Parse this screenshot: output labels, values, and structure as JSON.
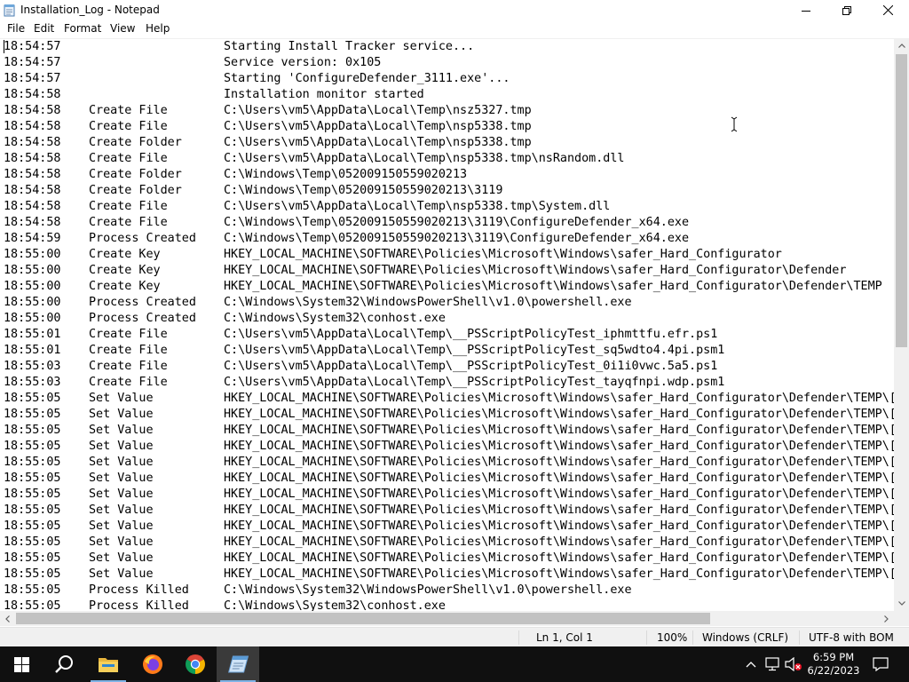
{
  "window": {
    "title": "Installation_Log - Notepad",
    "icon": "notepad-icon"
  },
  "menu": [
    "File",
    "Edit",
    "Format",
    "View",
    "Help"
  ],
  "log": [
    {
      "time": "18:54:57",
      "op": "",
      "path": "Starting Install Tracker service..."
    },
    {
      "time": "18:54:57",
      "op": "",
      "path": "Service version: 0x105"
    },
    {
      "time": "18:54:57",
      "op": "",
      "path": "Starting 'ConfigureDefender_3111.exe'..."
    },
    {
      "time": "18:54:58",
      "op": "",
      "path": "Installation monitor started"
    },
    {
      "time": "18:54:58",
      "op": "Create File",
      "path": "C:\\Users\\vm5\\AppData\\Local\\Temp\\nsz5327.tmp"
    },
    {
      "time": "18:54:58",
      "op": "Create File",
      "path": "C:\\Users\\vm5\\AppData\\Local\\Temp\\nsp5338.tmp"
    },
    {
      "time": "18:54:58",
      "op": "Create Folder",
      "path": "C:\\Users\\vm5\\AppData\\Local\\Temp\\nsp5338.tmp"
    },
    {
      "time": "18:54:58",
      "op": "Create File",
      "path": "C:\\Users\\vm5\\AppData\\Local\\Temp\\nsp5338.tmp\\nsRandom.dll"
    },
    {
      "time": "18:54:58",
      "op": "Create Folder",
      "path": "C:\\Windows\\Temp\\052009150559020213"
    },
    {
      "time": "18:54:58",
      "op": "Create Folder",
      "path": "C:\\Windows\\Temp\\052009150559020213\\3119"
    },
    {
      "time": "18:54:58",
      "op": "Create File",
      "path": "C:\\Users\\vm5\\AppData\\Local\\Temp\\nsp5338.tmp\\System.dll"
    },
    {
      "time": "18:54:58",
      "op": "Create File",
      "path": "C:\\Windows\\Temp\\052009150559020213\\3119\\ConfigureDefender_x64.exe"
    },
    {
      "time": "18:54:59",
      "op": "Process Created",
      "path": "C:\\Windows\\Temp\\052009150559020213\\3119\\ConfigureDefender_x64.exe"
    },
    {
      "time": "18:55:00",
      "op": "Create Key",
      "path": "HKEY_LOCAL_MACHINE\\SOFTWARE\\Policies\\Microsoft\\Windows\\safer_Hard_Configurator"
    },
    {
      "time": "18:55:00",
      "op": "Create Key",
      "path": "HKEY_LOCAL_MACHINE\\SOFTWARE\\Policies\\Microsoft\\Windows\\safer_Hard_Configurator\\Defender"
    },
    {
      "time": "18:55:00",
      "op": "Create Key",
      "path": "HKEY_LOCAL_MACHINE\\SOFTWARE\\Policies\\Microsoft\\Windows\\safer_Hard_Configurator\\Defender\\TEMP"
    },
    {
      "time": "18:55:00",
      "op": "Process Created",
      "path": "C:\\Windows\\System32\\WindowsPowerShell\\v1.0\\powershell.exe"
    },
    {
      "time": "18:55:00",
      "op": "Process Created",
      "path": "C:\\Windows\\System32\\conhost.exe"
    },
    {
      "time": "18:55:01",
      "op": "Create File",
      "path": "C:\\Users\\vm5\\AppData\\Local\\Temp\\__PSScriptPolicyTest_iphmttfu.efr.ps1"
    },
    {
      "time": "18:55:01",
      "op": "Create File",
      "path": "C:\\Users\\vm5\\AppData\\Local\\Temp\\__PSScriptPolicyTest_sq5wdto4.4pi.psm1"
    },
    {
      "time": "18:55:03",
      "op": "Create File",
      "path": "C:\\Users\\vm5\\AppData\\Local\\Temp\\__PSScriptPolicyTest_0i1i0vwc.5a5.ps1"
    },
    {
      "time": "18:55:03",
      "op": "Create File",
      "path": "C:\\Users\\vm5\\AppData\\Local\\Temp\\__PSScriptPolicyTest_tayqfnpi.wdp.psm1"
    },
    {
      "time": "18:55:05",
      "op": "Set Value",
      "path": "HKEY_LOCAL_MACHINE\\SOFTWARE\\Policies\\Microsoft\\Windows\\safer_Hard_Configurator\\Defender\\TEMP\\["
    },
    {
      "time": "18:55:05",
      "op": "Set Value",
      "path": "HKEY_LOCAL_MACHINE\\SOFTWARE\\Policies\\Microsoft\\Windows\\safer_Hard_Configurator\\Defender\\TEMP\\["
    },
    {
      "time": "18:55:05",
      "op": "Set Value",
      "path": "HKEY_LOCAL_MACHINE\\SOFTWARE\\Policies\\Microsoft\\Windows\\safer_Hard_Configurator\\Defender\\TEMP\\["
    },
    {
      "time": "18:55:05",
      "op": "Set Value",
      "path": "HKEY_LOCAL_MACHINE\\SOFTWARE\\Policies\\Microsoft\\Windows\\safer_Hard_Configurator\\Defender\\TEMP\\["
    },
    {
      "time": "18:55:05",
      "op": "Set Value",
      "path": "HKEY_LOCAL_MACHINE\\SOFTWARE\\Policies\\Microsoft\\Windows\\safer_Hard_Configurator\\Defender\\TEMP\\["
    },
    {
      "time": "18:55:05",
      "op": "Set Value",
      "path": "HKEY_LOCAL_MACHINE\\SOFTWARE\\Policies\\Microsoft\\Windows\\safer_Hard_Configurator\\Defender\\TEMP\\["
    },
    {
      "time": "18:55:05",
      "op": "Set Value",
      "path": "HKEY_LOCAL_MACHINE\\SOFTWARE\\Policies\\Microsoft\\Windows\\safer_Hard_Configurator\\Defender\\TEMP\\["
    },
    {
      "time": "18:55:05",
      "op": "Set Value",
      "path": "HKEY_LOCAL_MACHINE\\SOFTWARE\\Policies\\Microsoft\\Windows\\safer_Hard_Configurator\\Defender\\TEMP\\["
    },
    {
      "time": "18:55:05",
      "op": "Set Value",
      "path": "HKEY_LOCAL_MACHINE\\SOFTWARE\\Policies\\Microsoft\\Windows\\safer_Hard_Configurator\\Defender\\TEMP\\["
    },
    {
      "time": "18:55:05",
      "op": "Set Value",
      "path": "HKEY_LOCAL_MACHINE\\SOFTWARE\\Policies\\Microsoft\\Windows\\safer_Hard_Configurator\\Defender\\TEMP\\["
    },
    {
      "time": "18:55:05",
      "op": "Set Value",
      "path": "HKEY_LOCAL_MACHINE\\SOFTWARE\\Policies\\Microsoft\\Windows\\safer_Hard_Configurator\\Defender\\TEMP\\["
    },
    {
      "time": "18:55:05",
      "op": "Set Value",
      "path": "HKEY_LOCAL_MACHINE\\SOFTWARE\\Policies\\Microsoft\\Windows\\safer_Hard_Configurator\\Defender\\TEMP\\["
    },
    {
      "time": "18:55:05",
      "op": "Process Killed",
      "path": "C:\\Windows\\System32\\WindowsPowerShell\\v1.0\\powershell.exe"
    },
    {
      "time": "18:55:05",
      "op": "Process Killed",
      "path": "C:\\Windows\\System32\\conhost.exe"
    }
  ],
  "status": {
    "position": "Ln 1, Col 1",
    "zoom": "100%",
    "line_ending": "Windows (CRLF)",
    "encoding": "UTF-8 with BOM"
  },
  "taskbar": {
    "items": [
      "windows-start-icon",
      "search-icon",
      "file-explorer-icon",
      "firefox-icon",
      "chrome-icon",
      "notepad-icon"
    ],
    "clock_time": "6:59 PM",
    "clock_date": "6/22/2023"
  },
  "colors": {
    "taskbar_bg": "#101010",
    "active_item_bg": "#3a3a3a",
    "active_underline": "#7fb3e6",
    "chrome_bg": "#f0f0f0"
  }
}
